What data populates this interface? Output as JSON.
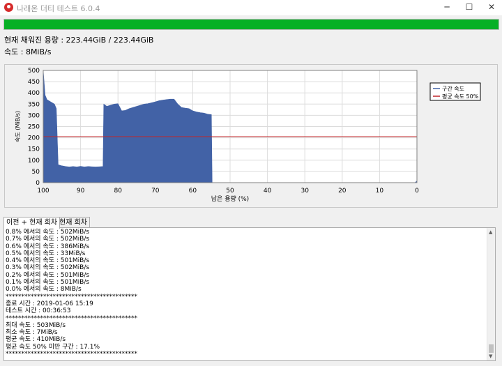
{
  "window": {
    "title": "나래온 더티 테스트 6.0.4",
    "minimize": "─",
    "maximize": "☐",
    "close": "✕"
  },
  "progress": {
    "fraction": 1.0,
    "color": "#06b025"
  },
  "info": {
    "used": "현재 채워진 용량 : 223.44GiB / 223.44GiB",
    "speed": "속도 : 8MiB/s"
  },
  "chart_data": {
    "type": "area",
    "xlabel": "남은 용량 (%)",
    "ylabel": "속도 (MiB/s)",
    "xlim": [
      100,
      0
    ],
    "ylim": [
      0,
      500
    ],
    "x_ticks": [
      100,
      90,
      80,
      70,
      60,
      50,
      40,
      30,
      20,
      10,
      0
    ],
    "y_ticks": [
      0,
      50,
      100,
      150,
      200,
      250,
      300,
      350,
      400,
      450,
      500
    ],
    "grid": true,
    "legend_position": "right",
    "series": [
      {
        "name": "구간 속도",
        "color": "#4262a6",
        "x": [
          100,
          99.5,
          99,
          98,
          97,
          96.5,
          96,
          95,
          94,
          93,
          92,
          91,
          90,
          89,
          88,
          87,
          86,
          85,
          84,
          83.8,
          83,
          82,
          81,
          80,
          79,
          78,
          77,
          76,
          75,
          74,
          73,
          72,
          71,
          70,
          69,
          68,
          67,
          66,
          65,
          64,
          63,
          62,
          61,
          60,
          59,
          58,
          57,
          56,
          55,
          54.8,
          54,
          50,
          45,
          40,
          35,
          30,
          25,
          20,
          15,
          10,
          5,
          2,
          1,
          0.5,
          0
        ],
        "y": [
          500,
          390,
          370,
          360,
          350,
          330,
          80,
          75,
          72,
          70,
          72,
          70,
          73,
          70,
          72,
          71,
          70,
          71,
          72,
          350,
          340,
          345,
          350,
          352,
          320,
          322,
          330,
          335,
          340,
          345,
          350,
          352,
          356,
          360,
          365,
          368,
          370,
          372,
          372,
          350,
          335,
          332,
          330,
          320,
          315,
          312,
          310,
          305,
          303,
          0,
          0,
          0,
          0,
          0,
          0,
          0,
          0,
          0,
          0,
          0,
          0,
          0,
          0,
          0,
          8
        ]
      },
      {
        "name": "평균 속도 50%",
        "color": "#c0262a",
        "x": [
          100,
          0
        ],
        "y": [
          205,
          205
        ]
      }
    ]
  },
  "tabs": [
    {
      "label": "이전 + 현재 회차",
      "active": true
    },
    {
      "label": "현재 회차",
      "active": false
    }
  ],
  "log": [
    "0.8% 에서의 속도 : 502MiB/s",
    "0.7% 에서의 속도 : 502MiB/s",
    "0.6% 에서의 속도 : 386MiB/s",
    "0.5% 에서의 속도 : 33MiB/s",
    "0.4% 에서의 속도 : 501MiB/s",
    "0.3% 에서의 속도 : 502MiB/s",
    "0.2% 에서의 속도 : 501MiB/s",
    "0.1% 에서의 속도 : 501MiB/s",
    "0.0% 에서의 속도 : 8MiB/s",
    "******************************************",
    "종료 시간 : 2019-01-06 15:19",
    "테스트 시간 : 00:36:53",
    "******************************************",
    "최대 속도 : 503MiB/s",
    "최소 속도 : 7MiB/s",
    "평균 속도 : 410MiB/s",
    "평균 속도 50% 미만 구간 : 17.1%",
    "******************************************"
  ],
  "scrollbar": {
    "up": "▲",
    "down": "▼"
  }
}
